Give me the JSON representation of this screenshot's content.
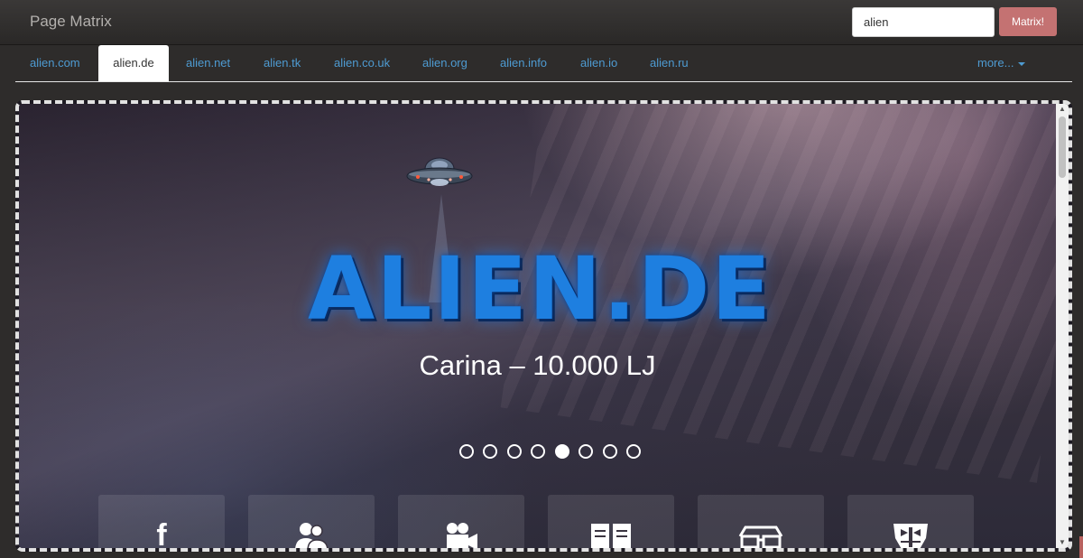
{
  "navbar": {
    "brand": "Page Matrix",
    "search_value": "alien",
    "button_label": "Matrix!"
  },
  "tabs": {
    "items": [
      "alien.com",
      "alien.de",
      "alien.net",
      "alien.tk",
      "alien.co.uk",
      "alien.org",
      "alien.info",
      "alien.io",
      "alien.ru"
    ],
    "active": "alien.de",
    "more_label": "more..."
  },
  "preview": {
    "logo_text": "ALIEN.DE",
    "caption": "Carina – 10.000 LJ",
    "slide_count": 8,
    "active_slide": 5,
    "tiles": [
      "facebook-icon",
      "users-icon",
      "video-camera-icon",
      "book-icon",
      "3d-glasses-icon",
      "transformers-icon"
    ]
  },
  "colors": {
    "link": "#4e9bd2",
    "button": "#c47272",
    "logo_blue": "#1e7fe0"
  }
}
